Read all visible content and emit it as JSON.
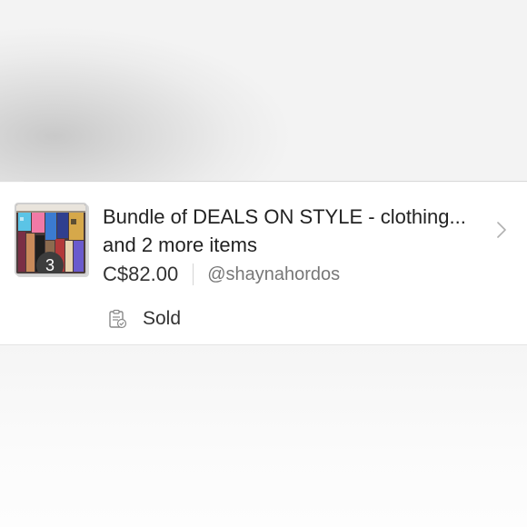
{
  "order": {
    "title": "Bundle of DEALS ON STYLE - clothing... and 2 more items",
    "price": "C$82.00",
    "seller": "@shaynahordos",
    "item_count": "3",
    "status": "Sold",
    "status_icon": "clipboard-check-icon",
    "thumbnail": "clothing-rack-photo",
    "chevron_icon": "chevron-right-icon"
  }
}
